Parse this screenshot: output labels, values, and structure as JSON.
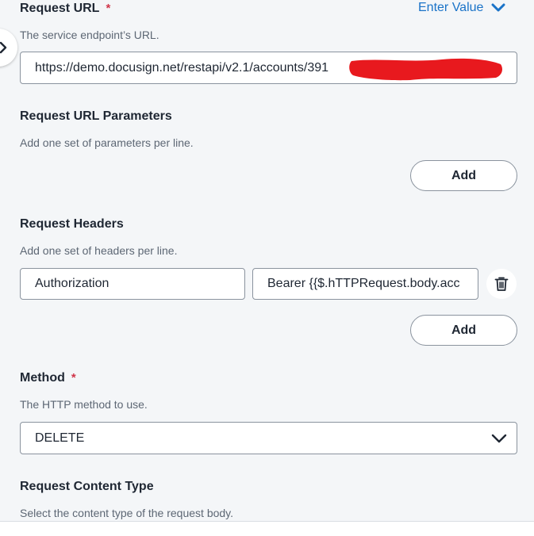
{
  "request_url": {
    "title": "Request URL",
    "required_mark": "*",
    "mode_toggle_label": "Enter Value",
    "description": "The service endpoint’s URL.",
    "value": "https://demo.docusign.net/restapi/v2.1/accounts/391"
  },
  "url_parameters": {
    "title": "Request URL Parameters",
    "description": "Add one set of parameters per line.",
    "add_label": "Add"
  },
  "headers": {
    "title": "Request Headers",
    "description": "Add one set of headers per line.",
    "rows": [
      {
        "name": "Authorization",
        "value": "Bearer {{$.hTTPRequest.body.acc"
      }
    ],
    "add_label": "Add"
  },
  "method": {
    "title": "Method",
    "required_mark": "*",
    "description": "The HTTP method to use.",
    "selected": "DELETE"
  },
  "content_type": {
    "title": "Request Content Type",
    "description": "Select the content type of the request body."
  },
  "colors": {
    "background": "#f4f6f8",
    "accent": "#1a73c8",
    "required": "#d0364a",
    "redaction": "#e8191e"
  },
  "icons": {
    "side_handle": "chevron-right-icon",
    "mode_toggle": "chevron-down-icon",
    "header_delete": "trash-icon",
    "method_select": "chevron-down-icon"
  }
}
